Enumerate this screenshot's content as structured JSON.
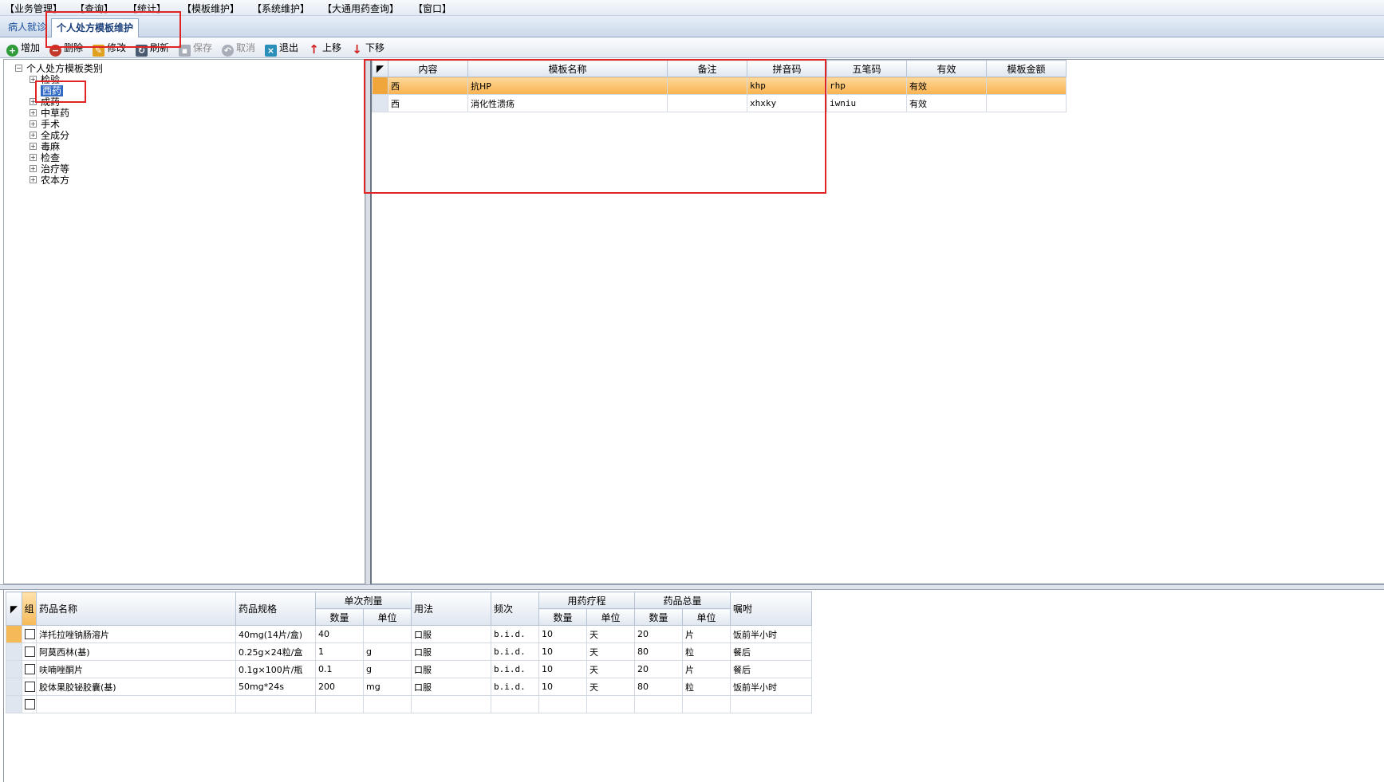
{
  "menu": [
    "【业务管理】",
    "【查询】",
    "【统计】",
    "【模板维护】",
    "【系统维护】",
    "【大通用药查询】",
    "【窗口】"
  ],
  "tabs": {
    "inactive": "病人就诊",
    "active": "个人处方模板维护"
  },
  "toolbar": {
    "add": "增加",
    "delete": "删除",
    "modify": "修改",
    "refresh": "刷新",
    "save": "保存",
    "cancel": "取消",
    "exit": "退出",
    "up": "上移",
    "down": "下移"
  },
  "tree": {
    "root": "个人处方模板类别",
    "items": [
      "检验",
      "西药",
      "成药",
      "中草药",
      "手术",
      "全成分",
      "毒麻",
      "检查",
      "治疗等",
      "农本方"
    ]
  },
  "template_grid": {
    "headers": [
      "内容",
      "模板名称",
      "备注",
      "拼音码",
      "五笔码",
      "有效",
      "模板金额"
    ],
    "rows": [
      [
        "西",
        "抗HP",
        "",
        "khp",
        "rhp",
        "有效",
        ""
      ],
      [
        "西",
        "消化性溃疡",
        "",
        "xhxky",
        "iwniu",
        "有效",
        ""
      ]
    ]
  },
  "drug_grid": {
    "headers": {
      "group": "组",
      "name": "药品名称",
      "spec": "药品规格",
      "single_dose": "单次剂量",
      "qty": "数量",
      "unit": "单位",
      "usage": "用法",
      "freq": "频次",
      "course": "用药疗程",
      "course_qty": "数量",
      "course_unit": "单位",
      "total": "药品总量",
      "total_qty": "数量",
      "total_unit": "单位",
      "advice": "嘱咐"
    },
    "rows": [
      [
        "洋托拉唑钠肠溶片",
        "40mg(14片/盒)",
        "40",
        "",
        "口服",
        "b.i.d.",
        "10",
        "天",
        "20",
        "片",
        "饭前半小时"
      ],
      [
        "阿莫西林(基)",
        "0.25g×24粒/盒",
        "1",
        "g",
        "口服",
        "b.i.d.",
        "10",
        "天",
        "80",
        "粒",
        "餐后"
      ],
      [
        "呋喃唑酮片",
        "0.1g×100片/瓶",
        "0.1",
        "g",
        "口服",
        "b.i.d.",
        "10",
        "天",
        "20",
        "片",
        "餐后"
      ],
      [
        "胶体果胶铋胶囊(基)",
        "50mg*24s",
        "200",
        "mg",
        "口服",
        "b.i.d.",
        "10",
        "天",
        "80",
        "粒",
        "饭前半小时"
      ]
    ]
  },
  "colors": {
    "highlight": "#f8b24f",
    "annotation": "#e02424",
    "selection": "#316ac5"
  }
}
